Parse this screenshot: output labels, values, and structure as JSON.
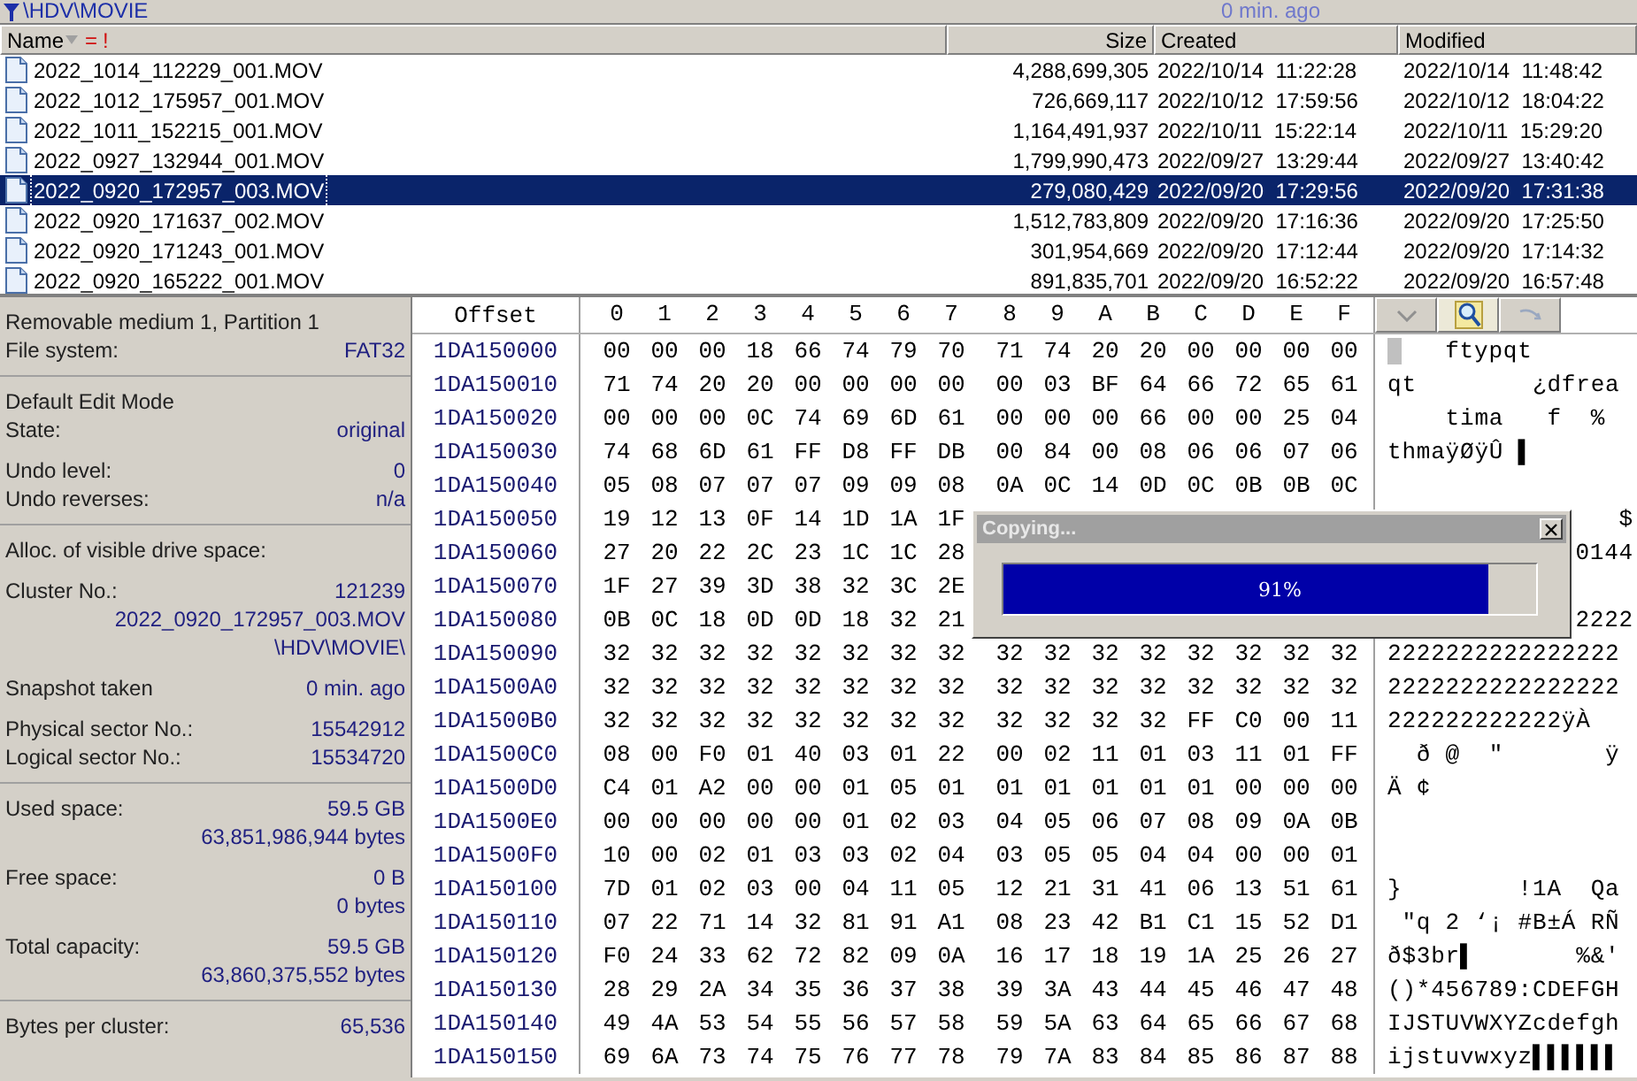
{
  "path_bar": {
    "path": "\\HDV\\MOVIE",
    "snapshot_age": "0 min. ago"
  },
  "file_list": {
    "columns": [
      {
        "label": "Name"
      },
      {
        "label": "Size"
      },
      {
        "label": "Created"
      },
      {
        "label": "Modified"
      }
    ],
    "sort_marks": [
      "=",
      "!"
    ],
    "rows": [
      {
        "name": "2022_1014_112229_001.MOV",
        "size": "4,288,699,305",
        "created": "2022/10/14  11:22:28",
        "modified": "2022/10/14  11:48:42",
        "selected": false
      },
      {
        "name": "2022_1012_175957_001.MOV",
        "size": "726,669,117",
        "created": "2022/10/12  17:59:56",
        "modified": "2022/10/12  18:04:22",
        "selected": false
      },
      {
        "name": "2022_1011_152215_001.MOV",
        "size": "1,164,491,937",
        "created": "2022/10/11  15:22:14",
        "modified": "2022/10/11  15:29:20",
        "selected": false
      },
      {
        "name": "2022_0927_132944_001.MOV",
        "size": "1,799,990,473",
        "created": "2022/09/27  13:29:44",
        "modified": "2022/09/27  13:40:42",
        "selected": false
      },
      {
        "name": "2022_0920_172957_003.MOV",
        "size": "279,080,429",
        "created": "2022/09/20  17:29:56",
        "modified": "2022/09/20  17:31:38",
        "selected": true
      },
      {
        "name": "2022_0920_171637_002.MOV",
        "size": "1,512,783,809",
        "created": "2022/09/20  17:16:36",
        "modified": "2022/09/20  17:25:50",
        "selected": false
      },
      {
        "name": "2022_0920_171243_001.MOV",
        "size": "301,954,669",
        "created": "2022/09/20  17:12:44",
        "modified": "2022/09/20  17:14:32",
        "selected": false
      },
      {
        "name": "2022_0920_165222_001.MOV",
        "size": "891,835,701",
        "created": "2022/09/20  16:52:22",
        "modified": "2022/09/20  16:57:48",
        "selected": false
      }
    ]
  },
  "info_panel": {
    "sections": [
      {
        "groups": [
          [
            {
              "kind": "pair",
              "label": "Removable medium 1, Partition 1"
            },
            {
              "kind": "pair",
              "label": "File system:",
              "value": "FAT32"
            }
          ]
        ]
      },
      {
        "groups": [
          [
            {
              "kind": "pair",
              "label": "Default Edit Mode"
            },
            {
              "kind": "pair",
              "label": "State:",
              "value": "original"
            }
          ],
          [
            {
              "kind": "pair",
              "label": "Undo level:",
              "value": "0"
            },
            {
              "kind": "pair",
              "label": "Undo reverses:",
              "value": "n/a"
            }
          ]
        ]
      },
      {
        "groups": [
          [
            {
              "kind": "pair",
              "label": "Alloc. of visible drive space:"
            }
          ],
          [
            {
              "kind": "pair",
              "label": "Cluster No.:",
              "value": "121239"
            },
            {
              "kind": "value",
              "value": "2022_0920_172957_003.MOV"
            },
            {
              "kind": "value",
              "value": "\\HDV\\MOVIE\\"
            }
          ],
          [
            {
              "kind": "pair",
              "label": "Snapshot taken",
              "value": "0 min. ago"
            }
          ],
          [
            {
              "kind": "pair",
              "label": "Physical sector No.:",
              "value": "15542912"
            },
            {
              "kind": "pair",
              "label": "Logical sector No.:",
              "value": "15534720"
            }
          ]
        ]
      },
      {
        "groups": [
          [
            {
              "kind": "pair",
              "label": "Used space:",
              "value": "59.5 GB"
            },
            {
              "kind": "value",
              "value": "63,851,986,944 bytes"
            }
          ],
          [
            {
              "kind": "pair",
              "label": "Free space:",
              "value": "0 B"
            },
            {
              "kind": "value",
              "value": "0 bytes"
            }
          ],
          [
            {
              "kind": "pair",
              "label": "Total capacity:",
              "value": "59.5 GB"
            },
            {
              "kind": "value",
              "value": "63,860,375,552 bytes"
            }
          ]
        ]
      },
      {
        "groups": [
          [
            {
              "kind": "pair",
              "label": "Bytes per cluster:",
              "value": "65,536"
            }
          ]
        ]
      }
    ]
  },
  "hex_view": {
    "offset_header": "Offset",
    "column_headers": [
      "0",
      "1",
      "2",
      "3",
      "4",
      "5",
      "6",
      "7",
      "8",
      "9",
      "A",
      "B",
      "C",
      "D",
      "E",
      "F"
    ],
    "rows": [
      {
        "offset": "1DA150000",
        "bytes": [
          "00",
          "00",
          "00",
          "18",
          "66",
          "74",
          "79",
          "70",
          "71",
          "74",
          "20",
          "20",
          "00",
          "00",
          "00",
          "00"
        ],
        "text": "   ftypqt",
        "cursor": true
      },
      {
        "offset": "1DA150010",
        "bytes": [
          "71",
          "74",
          "20",
          "20",
          "00",
          "00",
          "00",
          "00",
          "00",
          "03",
          "BF",
          "64",
          "66",
          "72",
          "65",
          "61"
        ],
        "text": "qt        ¿dfrea"
      },
      {
        "offset": "1DA150020",
        "bytes": [
          "00",
          "00",
          "00",
          "0C",
          "74",
          "69",
          "6D",
          "61",
          "00",
          "00",
          "00",
          "66",
          "00",
          "00",
          "25",
          "04"
        ],
        "text": "    tima   f  %"
      },
      {
        "offset": "1DA150030",
        "bytes": [
          "74",
          "68",
          "6D",
          "61",
          "FF",
          "D8",
          "FF",
          "DB",
          "00",
          "84",
          "00",
          "08",
          "06",
          "06",
          "07",
          "06"
        ],
        "text": "thmaÿØÿÛ ▌"
      },
      {
        "offset": "1DA150040",
        "bytes": [
          "05",
          "08",
          "07",
          "07",
          "07",
          "09",
          "09",
          "08",
          "0A",
          "0C",
          "14",
          "0D",
          "0C",
          "0B",
          "0B",
          "0C"
        ]
      },
      {
        "offset": "1DA150050",
        "bytes": [
          "19",
          "12",
          "13",
          "0F",
          "14",
          "1D",
          "1A",
          "1F"
        ],
        "text": "$"
      },
      {
        "offset": "1DA150060",
        "bytes": [
          "27",
          "20",
          "22",
          "2C",
          "23",
          "1C",
          "1C",
          "28"
        ],
        "text": "0144"
      },
      {
        "offset": "1DA150070",
        "bytes": [
          "1F",
          "27",
          "39",
          "3D",
          "38",
          "32",
          "3C",
          "2E"
        ]
      },
      {
        "offset": "1DA150080",
        "bytes": [
          "0B",
          "0C",
          "18",
          "0D",
          "0D",
          "18",
          "32",
          "21"
        ],
        "text": "2222"
      },
      {
        "offset": "1DA150090",
        "bytes": [
          "32",
          "32",
          "32",
          "32",
          "32",
          "32",
          "32",
          "32",
          "32",
          "32",
          "32",
          "32",
          "32",
          "32",
          "32",
          "32"
        ],
        "text": "2222222222222222"
      },
      {
        "offset": "1DA1500A0",
        "bytes": [
          "32",
          "32",
          "32",
          "32",
          "32",
          "32",
          "32",
          "32",
          "32",
          "32",
          "32",
          "32",
          "32",
          "32",
          "32",
          "32"
        ],
        "text": "2222222222222222"
      },
      {
        "offset": "1DA1500B0",
        "bytes": [
          "32",
          "32",
          "32",
          "32",
          "32",
          "32",
          "32",
          "32",
          "32",
          "32",
          "32",
          "32",
          "FF",
          "C0",
          "00",
          "11"
        ],
        "text": "222222222222ÿÀ"
      },
      {
        "offset": "1DA1500C0",
        "bytes": [
          "08",
          "00",
          "F0",
          "01",
          "40",
          "03",
          "01",
          "22",
          "00",
          "02",
          "11",
          "01",
          "03",
          "11",
          "01",
          "FF"
        ],
        "text": "  ð @  \"       ÿ"
      },
      {
        "offset": "1DA1500D0",
        "bytes": [
          "C4",
          "01",
          "A2",
          "00",
          "00",
          "01",
          "05",
          "01",
          "01",
          "01",
          "01",
          "01",
          "01",
          "00",
          "00",
          "00"
        ],
        "text": "Ä ¢"
      },
      {
        "offset": "1DA1500E0",
        "bytes": [
          "00",
          "00",
          "00",
          "00",
          "00",
          "01",
          "02",
          "03",
          "04",
          "05",
          "06",
          "07",
          "08",
          "09",
          "0A",
          "0B"
        ]
      },
      {
        "offset": "1DA1500F0",
        "bytes": [
          "10",
          "00",
          "02",
          "01",
          "03",
          "03",
          "02",
          "04",
          "03",
          "05",
          "05",
          "04",
          "04",
          "00",
          "00",
          "01"
        ]
      },
      {
        "offset": "1DA150100",
        "bytes": [
          "7D",
          "01",
          "02",
          "03",
          "00",
          "04",
          "11",
          "05",
          "12",
          "21",
          "31",
          "41",
          "06",
          "13",
          "51",
          "61"
        ],
        "text": "}        !1A  Qa"
      },
      {
        "offset": "1DA150110",
        "bytes": [
          "07",
          "22",
          "71",
          "14",
          "32",
          "81",
          "91",
          "A1",
          "08",
          "23",
          "42",
          "B1",
          "C1",
          "15",
          "52",
          "D1"
        ],
        "text": " \"q 2 ‘¡ #B±Á RÑ"
      },
      {
        "offset": "1DA150120",
        "bytes": [
          "F0",
          "24",
          "33",
          "62",
          "72",
          "82",
          "09",
          "0A",
          "16",
          "17",
          "18",
          "19",
          "1A",
          "25",
          "26",
          "27"
        ],
        "text": "ð$3br▌       %&'"
      },
      {
        "offset": "1DA150130",
        "bytes": [
          "28",
          "29",
          "2A",
          "34",
          "35",
          "36",
          "37",
          "38",
          "39",
          "3A",
          "43",
          "44",
          "45",
          "46",
          "47",
          "48"
        ],
        "text": "()*456789:CDEFGH"
      },
      {
        "offset": "1DA150140",
        "bytes": [
          "49",
          "4A",
          "53",
          "54",
          "55",
          "56",
          "57",
          "58",
          "59",
          "5A",
          "63",
          "64",
          "65",
          "66",
          "67",
          "68"
        ],
        "text": "IJSTUVWXYZcdefgh"
      },
      {
        "offset": "1DA150150",
        "bytes": [
          "69",
          "6A",
          "73",
          "74",
          "75",
          "76",
          "77",
          "78",
          "79",
          "7A",
          "83",
          "84",
          "85",
          "86",
          "87",
          "88"
        ],
        "text": "ijstuvwxyz▌▌▌▌▌▌"
      }
    ],
    "toolbar": [
      {
        "kind": "dropdown",
        "selected": false
      },
      {
        "kind": "search",
        "selected": true
      },
      {
        "kind": "arrow",
        "selected": false
      }
    ]
  },
  "progress_dialog": {
    "title": "Copying...",
    "level": 0.91,
    "reading": "91%"
  }
}
